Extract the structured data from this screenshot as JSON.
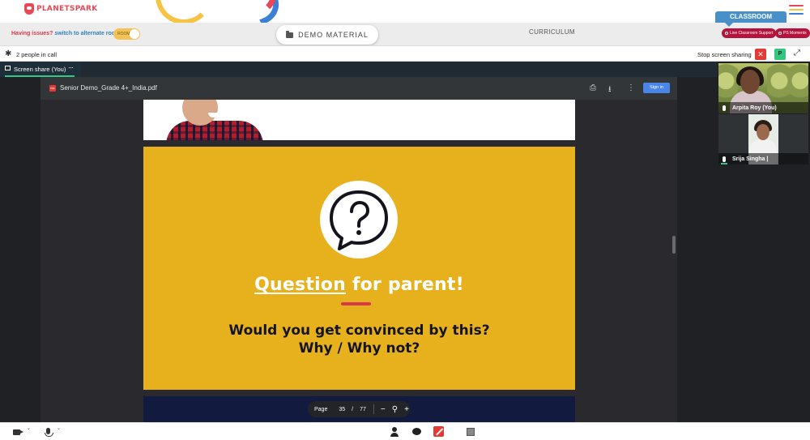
{
  "brand": {
    "name": "PLANETSPARK"
  },
  "subheader": {
    "issues_question": "Having issues?",
    "issues_link": "switch to alternate room",
    "toggle_label": "ROOM",
    "demo_button": "DEMO MATERIAL",
    "curriculum": "CURRICULUM",
    "classroom_tab": "CLASSROOM",
    "live_support": "Live Classroom Support",
    "ps_moments": "PS Moments"
  },
  "call_bar": {
    "people_count": "2 people in call",
    "stop_share": "Stop screen sharing",
    "close_icon_char": "✕",
    "p_badge": "P",
    "expand_char": "⤢"
  },
  "screen_share_tab": {
    "label": "Screen share (You)",
    "more": "···"
  },
  "pdf": {
    "filename": "Senior Demo_Grade 4+_India.pdf",
    "icon_text": "PDF",
    "sign_in": "Sign in",
    "slide_title_part1": "Question",
    "slide_title_part2": " for parent!",
    "slide_body_line1": "Would you get convinced by this?",
    "slide_body_line2": "Why / Why not?",
    "page_label": "Page",
    "page_current": "35",
    "page_sep": "/",
    "page_total": "77",
    "zoom_out": "−",
    "zoom_in": "+"
  },
  "participants": [
    {
      "name": "Arpita Roy (You)"
    },
    {
      "name": "Srija Singha |"
    }
  ],
  "colors": {
    "brand_red": "#e84856",
    "accent_blue": "#4a90c8",
    "slide_yellow": "#e6b11d",
    "share_green": "#35c48a",
    "danger_red": "#e53935",
    "hamburger": [
      "#e84856",
      "#f6c343",
      "#3b7fd6"
    ]
  },
  "icons": {
    "settings": "gear-icon",
    "print": "print-icon",
    "download": "download-icon",
    "more": "more-vert-icon",
    "camera": "camera-icon",
    "mic": "mic-icon",
    "participants": "person-icon",
    "chat": "chat-icon",
    "screen_share_off": "screen-share-off-icon",
    "whiteboard": "square-icon"
  }
}
